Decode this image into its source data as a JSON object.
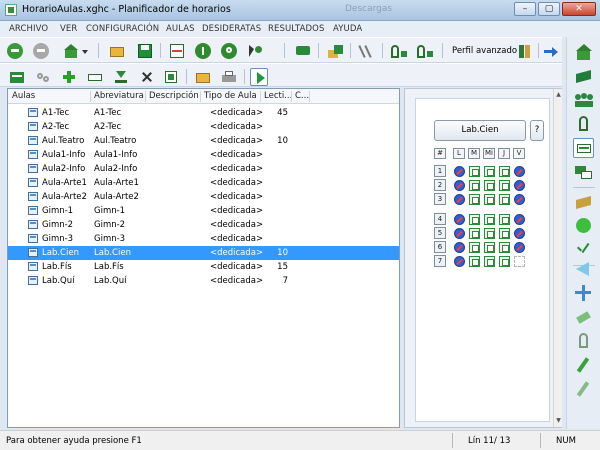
{
  "window": {
    "title": "HorarioAulas.xghc - Planificador de horarios",
    "background_tab": "Descargas",
    "controls": [
      "–",
      "▢",
      "✕"
    ]
  },
  "menu": [
    "ARCHIVO",
    "VER",
    "CONFIGURACIÓN",
    "AULAS",
    "DESIDERATAS",
    "RESULTADOS",
    "AYUDA"
  ],
  "toolbar": {
    "profile_label": "Perfil avanzado"
  },
  "table": {
    "columns": [
      "Aulas",
      "Abreviatura",
      "Descripción",
      "Tipo de Aula",
      "Lecti...",
      "C..."
    ],
    "rows": [
      {
        "name": "A1-Tec",
        "abbr": "A1-Tec",
        "desc": "",
        "type": "<dedicada>",
        "lect": "45",
        "c": ""
      },
      {
        "name": "A2-Tec",
        "abbr": "A2-Tec",
        "desc": "",
        "type": "<dedicada>",
        "lect": "",
        "c": ""
      },
      {
        "name": "Aul.Teatro",
        "abbr": "Aul.Teatro",
        "desc": "",
        "type": "<dedicada>",
        "lect": "10",
        "c": ""
      },
      {
        "name": "Aula1-Info",
        "abbr": "Aula1-Info",
        "desc": "",
        "type": "<dedicada>",
        "lect": "",
        "c": ""
      },
      {
        "name": "Aula2-Info",
        "abbr": "Aula2-Info",
        "desc": "",
        "type": "<dedicada>",
        "lect": "",
        "c": ""
      },
      {
        "name": "Aula-Arte1",
        "abbr": "Aula-Arte1",
        "desc": "",
        "type": "<dedicada>",
        "lect": "",
        "c": ""
      },
      {
        "name": "Aula-Arte2",
        "abbr": "Aula-Arte2",
        "desc": "",
        "type": "<dedicada>",
        "lect": "",
        "c": ""
      },
      {
        "name": "Gimn-1",
        "abbr": "Gimn-1",
        "desc": "",
        "type": "<dedicada>",
        "lect": "",
        "c": ""
      },
      {
        "name": "Gimn-2",
        "abbr": "Gimn-2",
        "desc": "",
        "type": "<dedicada>",
        "lect": "",
        "c": ""
      },
      {
        "name": "Gimn-3",
        "abbr": "Gimn-3",
        "desc": "",
        "type": "<dedicada>",
        "lect": "",
        "c": ""
      },
      {
        "name": "Lab.Cien",
        "abbr": "Lab.Cien",
        "desc": "",
        "type": "<dedicada>",
        "lect": "10",
        "c": ""
      },
      {
        "name": "Lab.Fís",
        "abbr": "Lab.Fís",
        "desc": "",
        "type": "<dedicada>",
        "lect": "15",
        "c": ""
      },
      {
        "name": "Lab.Quí",
        "abbr": "Lab.Quí",
        "desc": "",
        "type": "<dedicada>",
        "lect": "7",
        "c": ""
      }
    ],
    "selected_index": 10
  },
  "schedule": {
    "room_button": "Lab.Cien",
    "help_button": "?",
    "corner": "#",
    "days": [
      "L",
      "M",
      "Mi",
      "J",
      "V"
    ],
    "periods": [
      "1",
      "2",
      "3",
      "4",
      "5",
      "6",
      "7"
    ],
    "grid": [
      [
        "blocked",
        "free",
        "free",
        "free",
        "blocked"
      ],
      [
        "blocked",
        "free",
        "free",
        "free",
        "blocked"
      ],
      [
        "blocked",
        "free",
        "free",
        "free",
        "blocked"
      ],
      [
        "blocked",
        "free",
        "free",
        "free",
        "blocked"
      ],
      [
        "blocked",
        "free",
        "free",
        "free",
        "blocked"
      ],
      [
        "blocked",
        "free",
        "free",
        "free",
        "blocked"
      ],
      [
        "blocked",
        "free",
        "free",
        "free",
        "ghost"
      ]
    ]
  },
  "status": {
    "help": "Para obtener ayuda presione F1",
    "position": "Lín 11/ 13",
    "numlock": "NUM"
  },
  "colors": {
    "selection": "#3399ff",
    "free_slot": "#2d8a3a",
    "blocked_slot": "#2f5fd0"
  }
}
